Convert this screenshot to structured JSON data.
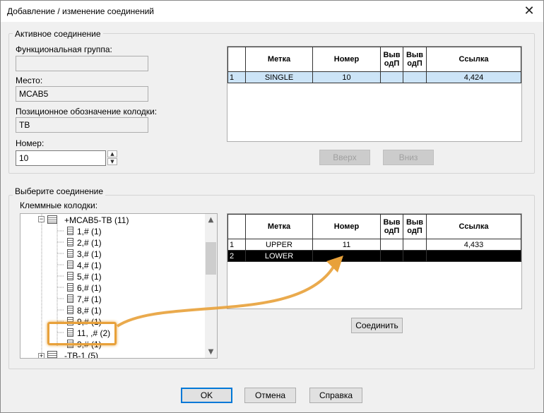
{
  "window": {
    "title": "Добавление / изменение соединений",
    "close_icon": "close-icon"
  },
  "active": {
    "group_label": "Активное соединение",
    "func_group_label": "Функциональная группа:",
    "func_group_value": "",
    "place_label": "Место:",
    "place_value": "MCAB5",
    "designation_label": "Позиционное обозначение колодки:",
    "designation_value": "TB",
    "number_label": "Номер:",
    "number_value": "10",
    "table": {
      "headers": [
        "Метка",
        "Номер",
        "Выв одП",
        "Выв одП",
        "Ссылка"
      ],
      "rows": [
        {
          "rn": "1",
          "mark": "SINGLE",
          "num": "10",
          "v1": "",
          "v2": "",
          "ref": "4,424"
        }
      ]
    },
    "up_button": "Вверх",
    "down_button": "Вниз"
  },
  "choose": {
    "group_label": "Выберите соединение",
    "terminal_label": "Клеммные колодки:",
    "tree": [
      "+MCAB5-TB (11)",
      "1,# (1)",
      "2,# (1)",
      "3,# (1)",
      "4,# (1)",
      "5,# (1)",
      "6,# (1)",
      "7,# (1)",
      "8,# (1)",
      "9,# (1)",
      "11, ,# (2)",
      "9,# (1)",
      "-TB-1 (5)"
    ],
    "table": {
      "headers": [
        "Метка",
        "Номер",
        "Выв одП",
        "Выв одП",
        "Ссылка"
      ],
      "rows": [
        {
          "rn": "1",
          "mark": "UPPER",
          "num": "11",
          "v1": "",
          "v2": "",
          "ref": "4,433"
        },
        {
          "rn": "2",
          "mark": "LOWER",
          "num": "",
          "v1": "",
          "v2": "",
          "ref": ""
        }
      ]
    },
    "connect_button": "Соединить"
  },
  "footer": {
    "ok": "OK",
    "cancel": "Отмена",
    "help": "Справка"
  },
  "colors": {
    "highlight": "#e8a13a",
    "selection": "#cce4f7",
    "default_button_border": "#0078d7"
  }
}
